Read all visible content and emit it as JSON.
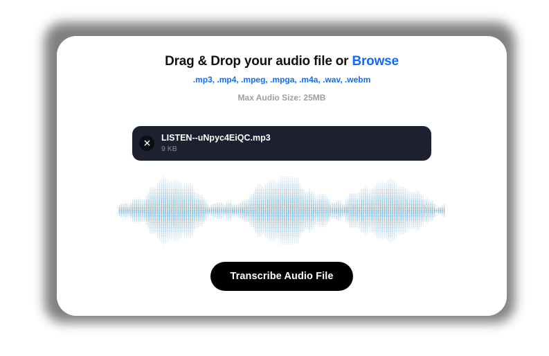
{
  "upload": {
    "title_prefix": "Drag & Drop your audio file or ",
    "title_browse": "Browse",
    "formats_line": ".mp3, .mp4, .mpeg, .mpga, .m4a, .wav, .webm",
    "max_size_line": "Max Audio Size: 25MB"
  },
  "file": {
    "name": "LISTEN--uNpyc4EiQC.mp3",
    "size": "9 KB"
  },
  "action": {
    "label": "Transcribe Audio File"
  },
  "icons": {
    "close": "close-icon"
  },
  "waveform": {
    "color_start": "#c24ea0",
    "color_mid": "#3aa6d8",
    "color_end": "#19b3b3"
  }
}
